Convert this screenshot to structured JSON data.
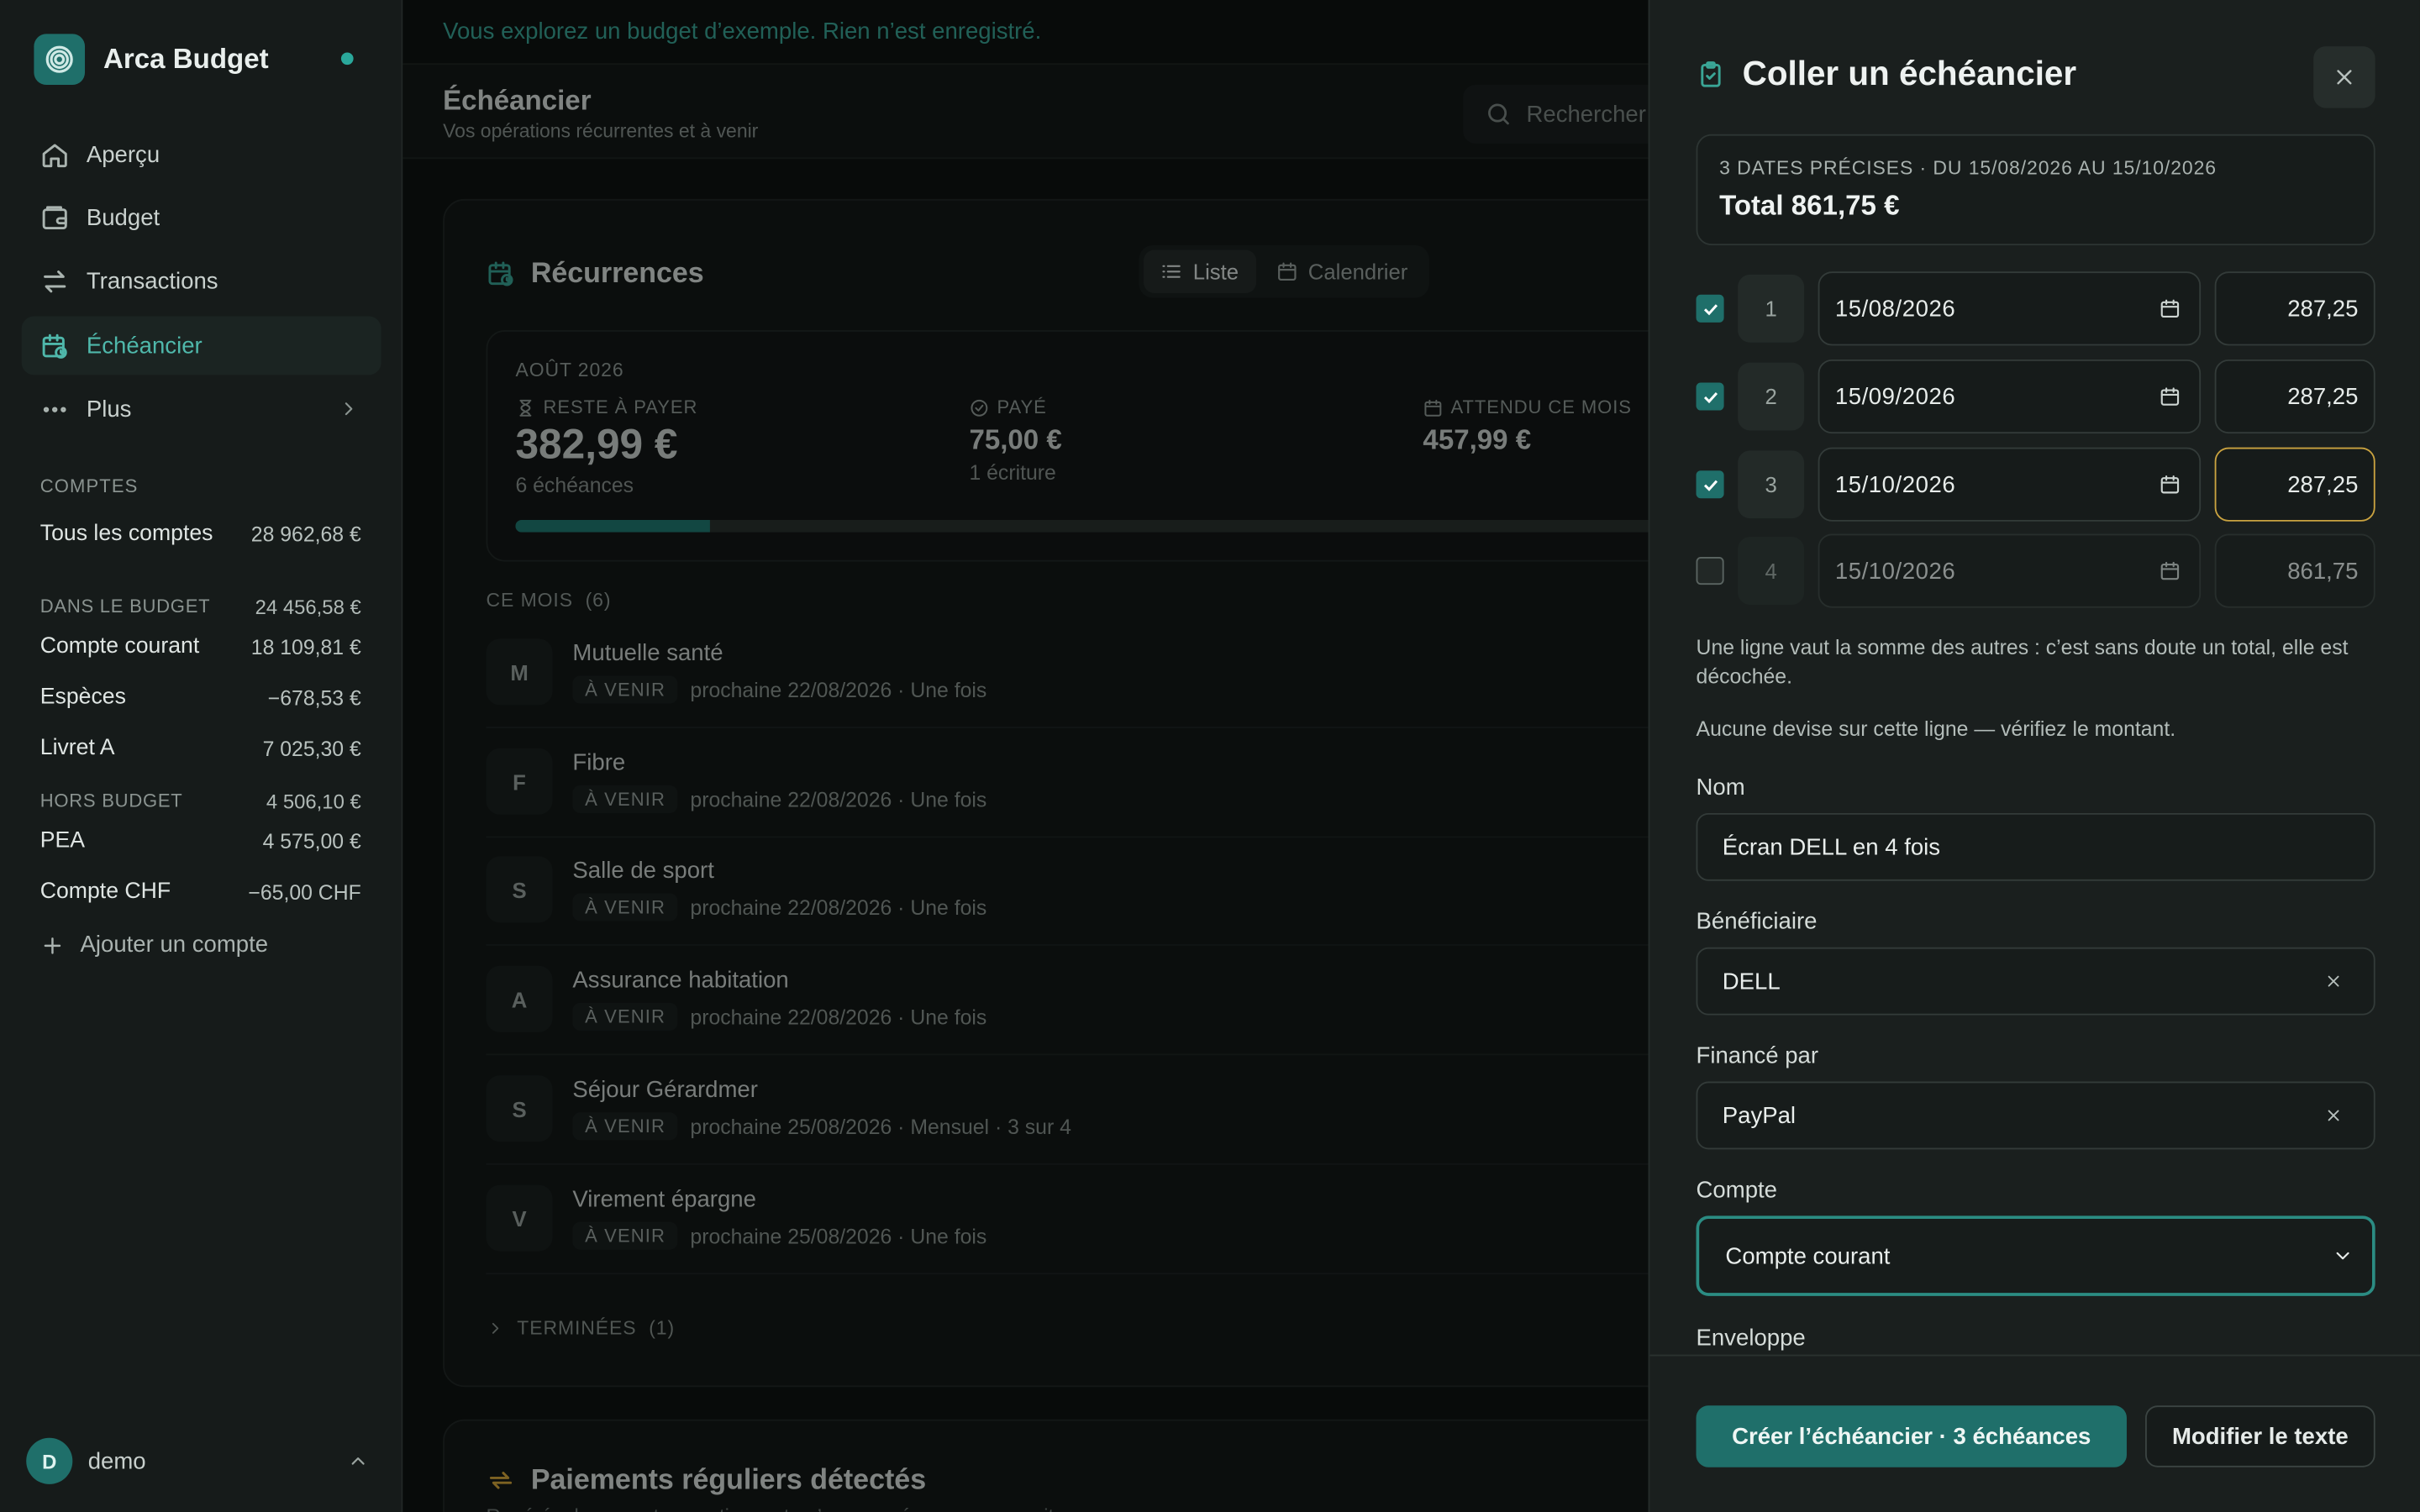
{
  "app": {
    "name": "Arca Budget"
  },
  "sidebar": {
    "nav": [
      {
        "label": "Aperçu",
        "icon": "home-icon"
      },
      {
        "label": "Budget",
        "icon": "wallet-icon"
      },
      {
        "label": "Transactions",
        "icon": "transfer-icon"
      },
      {
        "label": "Échéancier",
        "icon": "calendar-clock-icon",
        "active": true
      },
      {
        "label": "Plus",
        "icon": "more-icon"
      }
    ],
    "accounts_label": "COMPTES",
    "all_accounts": {
      "label": "Tous les comptes",
      "balance": "28 962,68 €"
    },
    "in_budget": {
      "label": "DANS LE BUDGET",
      "balance": "24 456,58 €"
    },
    "in_budget_accounts": [
      {
        "name": "Compte courant",
        "balance": "18 109,81 €"
      },
      {
        "name": "Espèces",
        "balance": "−678,53 €"
      },
      {
        "name": "Livret A",
        "balance": "7 025,30 €"
      }
    ],
    "off_budget": {
      "label": "HORS BUDGET",
      "balance": "4 506,10 €"
    },
    "off_budget_accounts": [
      {
        "name": "PEA",
        "balance": "4 575,00 €"
      },
      {
        "name": "Compte CHF",
        "balance": "−65,00 CHF"
      }
    ],
    "add_account": "Ajouter un compte",
    "user": {
      "initial": "D",
      "name": "demo"
    }
  },
  "main": {
    "demo_banner": "Vous explorez un budget d’exemple. Rien n’est enregistré.",
    "title": "Échéancier",
    "subtitle": "Vos opérations récurrentes et à venir",
    "search_placeholder": "Rechercher",
    "recurrences": {
      "title": "Récurrences",
      "views": [
        "Liste",
        "Calendrier"
      ],
      "month": "AOÛT 2026",
      "remaining": {
        "label": "RESTE À PAYER",
        "value": "382,99 €",
        "sub": "6 échéances"
      },
      "paid": {
        "label": "PAYÉ",
        "value": "75,00 €",
        "sub": "1 écriture"
      },
      "expected": {
        "label": "ATTENDU CE MOIS",
        "value": "457,99 €"
      },
      "progress": 0.164,
      "this_month_label": "CE MOIS",
      "this_month_count": "(6)",
      "items": [
        {
          "initial": "M",
          "name": "Mutuelle santé",
          "status": "À VENIR",
          "detail": "prochaine 22/08/2026 · Une fois"
        },
        {
          "initial": "F",
          "name": "Fibre",
          "status": "À VENIR",
          "detail": "prochaine 22/08/2026 · Une fois"
        },
        {
          "initial": "S",
          "name": "Salle de sport",
          "status": "À VENIR",
          "detail": "prochaine 22/08/2026 · Une fois"
        },
        {
          "initial": "A",
          "name": "Assurance habitation",
          "status": "À VENIR",
          "detail": "prochaine 22/08/2026 · Une fois"
        },
        {
          "initial": "S",
          "name": "Séjour Gérardmer",
          "status": "À VENIR",
          "detail": "prochaine 25/08/2026 · Mensuel · 3 sur 4"
        },
        {
          "initial": "V",
          "name": "Virement épargne",
          "status": "À VENIR",
          "detail": "prochaine 25/08/2026 · Une fois"
        }
      ],
      "ended_label": "TERMINÉES",
      "ended_count": "(1)"
    },
    "detected": {
      "title": "Paiements réguliers détectés",
      "subtitle": "Repérés dans vos transactions, et qu’aucune récurrence ne suit encore"
    }
  },
  "panel": {
    "title": "Coller un échéancier",
    "range": "3 dates précises · du 15/08/2026 au 15/10/2026",
    "total": "Total 861,75 €",
    "lines": [
      {
        "index": "1",
        "date": "15/08/2026",
        "amount": "287,25",
        "checked": true
      },
      {
        "index": "2",
        "date": "15/09/2026",
        "amount": "287,25",
        "checked": true
      },
      {
        "index": "3",
        "date": "15/10/2026",
        "amount": "287,25",
        "checked": true
      },
      {
        "index": "4",
        "date": "15/10/2026",
        "amount": "861,75",
        "checked": false
      }
    ],
    "note_sum": "Une ligne vaut la somme des autres : c’est sans doute un total, elle est décochée.",
    "note_currency": "Aucune devise sur cette ligne — vérifiez le montant.",
    "name_label": "Nom",
    "name_value": "Écran DELL en 4 fois",
    "payee_label": "Bénéficiaire",
    "payee_value": "DELL",
    "funded_label": "Financé par",
    "funded_value": "PayPal",
    "account_label": "Compte",
    "account_value": "Compte courant",
    "envelope_label": "Enveloppe",
    "create_button": "Créer l’échéancier · 3 échéances",
    "edit_button": "Modifier le texte"
  },
  "colors": {
    "accent": "#1f6f6a",
    "accent_text": "#3aa596",
    "warn_border": "#caa340",
    "background": "#0f1312",
    "panel": "#1a1f1e"
  }
}
